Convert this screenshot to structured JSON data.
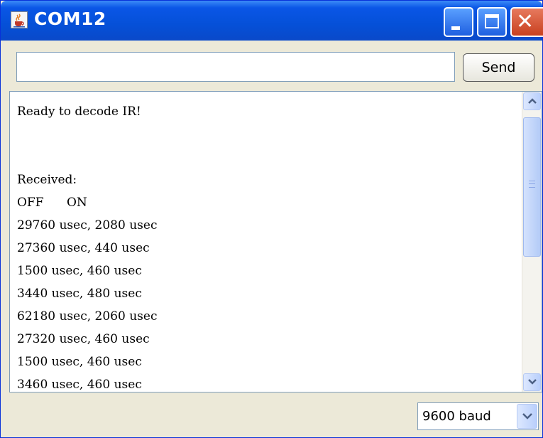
{
  "window": {
    "title": "COM12",
    "app_icon": "java-cup-icon",
    "controls": [
      "minimize-icon",
      "maximize-icon",
      "close-icon"
    ]
  },
  "send_bar": {
    "input_value": "",
    "send_label": "Send"
  },
  "console": {
    "lines": [
      "Ready to decode IR!",
      "",
      "",
      "Received:",
      "OFF      ON",
      "29760 usec, 2080 usec",
      "27360 usec, 440 usec",
      "1500 usec, 460 usec",
      "3440 usec, 480 usec",
      "62180 usec, 2060 usec",
      "27320 usec, 460 usec",
      "1500 usec, 460 usec",
      "3460 usec, 460 usec"
    ]
  },
  "status_bar": {
    "baud_rate": "9600 baud"
  },
  "colors": {
    "titlebar": "#0550d8",
    "close_button": "#d4502b",
    "window_bg": "#ece9d8"
  }
}
